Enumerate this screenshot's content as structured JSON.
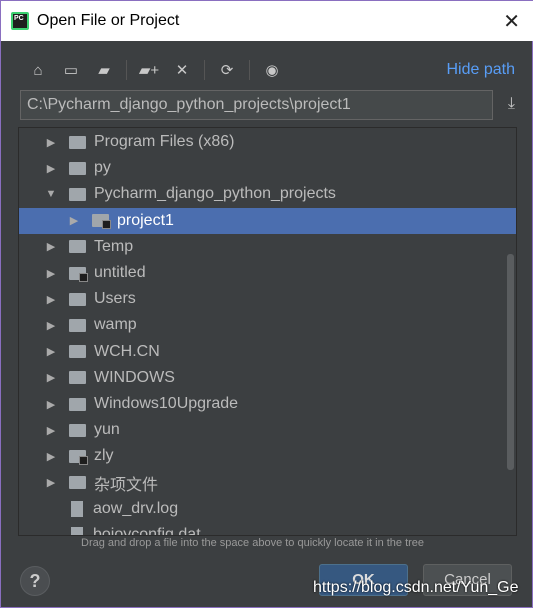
{
  "window": {
    "title": "Open File or Project",
    "close": "✕"
  },
  "toolbar": {
    "icons": [
      "home-icon",
      "desktop-icon",
      "project-folder-icon",
      "new-folder-icon",
      "delete-icon",
      "refresh-icon",
      "show-hidden-icon"
    ],
    "hide_path": "Hide path"
  },
  "path": {
    "value": "C:\\Pycharm_django_python_projects\\project1"
  },
  "tree": [
    {
      "label": "Program Files (x86)",
      "level": 0,
      "arrow": "▶",
      "type": "folder"
    },
    {
      "label": "py",
      "level": 0,
      "arrow": "▶",
      "type": "folder"
    },
    {
      "label": "Pycharm_django_python_projects",
      "level": 0,
      "arrow": "▼",
      "type": "folder"
    },
    {
      "label": "project1",
      "level": 1,
      "arrow": "▶",
      "type": "project",
      "selected": true
    },
    {
      "label": "Temp",
      "level": 0,
      "arrow": "▶",
      "type": "folder"
    },
    {
      "label": "untitled",
      "level": 0,
      "arrow": "▶",
      "type": "project"
    },
    {
      "label": "Users",
      "level": 0,
      "arrow": "▶",
      "type": "folder"
    },
    {
      "label": "wamp",
      "level": 0,
      "arrow": "▶",
      "type": "folder"
    },
    {
      "label": "WCH.CN",
      "level": 0,
      "arrow": "▶",
      "type": "folder"
    },
    {
      "label": "WINDOWS",
      "level": 0,
      "arrow": "▶",
      "type": "folder"
    },
    {
      "label": "Windows10Upgrade",
      "level": 0,
      "arrow": "▶",
      "type": "folder"
    },
    {
      "label": "yun",
      "level": 0,
      "arrow": "▶",
      "type": "folder"
    },
    {
      "label": "zly",
      "level": 0,
      "arrow": "▶",
      "type": "project"
    },
    {
      "label": "杂项文件",
      "level": 0,
      "arrow": "▶",
      "type": "folder"
    },
    {
      "label": "aow_drv.log",
      "level": 0,
      "arrow": "",
      "type": "file"
    },
    {
      "label": "bojoyconfig.dat",
      "level": 0,
      "arrow": "",
      "type": "file"
    }
  ],
  "hint": "Drag and drop a file into the space above to quickly locate it in the tree",
  "buttons": {
    "help": "?",
    "ok": "OK",
    "cancel": "Cancel"
  },
  "watermark": "https://blog.csdn.net/Yun_Ge",
  "colors": {
    "accent": "#589df6",
    "selection": "#4b6eaf",
    "background": "#3c3f41"
  }
}
